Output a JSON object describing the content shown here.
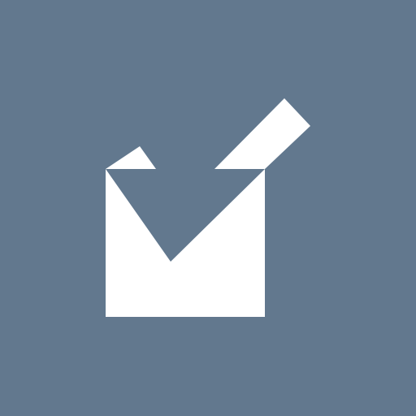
{
  "icon": {
    "name": "checkbox-checked-icon",
    "background_color": "#62788e",
    "foreground_color": "#ffffff"
  }
}
